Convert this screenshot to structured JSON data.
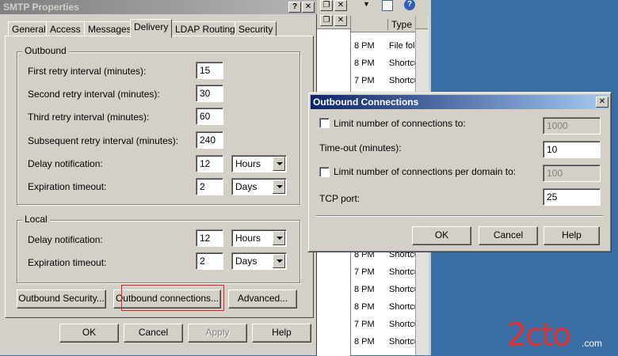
{
  "explorer": {
    "type_header": "Type",
    "rows": [
      {
        "time": "8 PM",
        "type": "File fold"
      },
      {
        "time": "8 PM",
        "type": "Shortcu"
      },
      {
        "time": "7 PM",
        "type": "Shortcu"
      },
      {
        "time": "8 PM",
        "type": "Shortcu"
      },
      {
        "time": "7 PM",
        "type": "Shortcu"
      },
      {
        "time": "8 PM",
        "type": "Shortcu"
      },
      {
        "time": "8 PM",
        "type": "Shortcu"
      },
      {
        "time": "7 PM",
        "type": "Shortcu"
      },
      {
        "time": "8 PM",
        "type": "Shortcu"
      }
    ]
  },
  "smtp_dialog": {
    "title": "SMTP Properties",
    "help_glyph": "?",
    "close_glyph": "✕",
    "tabs": [
      {
        "label": "General"
      },
      {
        "label": "Access"
      },
      {
        "label": "Messages"
      },
      {
        "label": "Delivery"
      },
      {
        "label": "LDAP Routing"
      },
      {
        "label": "Security"
      }
    ],
    "outbound": {
      "group_label": "Outbound",
      "first_retry_label": "First retry interval (minutes):",
      "first_retry_value": "15",
      "second_retry_label": "Second retry interval (minutes):",
      "second_retry_value": "30",
      "third_retry_label": "Third retry interval (minutes):",
      "third_retry_value": "60",
      "subsequent_retry_label": "Subsequent retry interval (minutes):",
      "subsequent_retry_value": "240",
      "delay_label": "Delay notification:",
      "delay_value": "12",
      "delay_unit": "Hours",
      "expiration_label": "Expiration timeout:",
      "expiration_value": "2",
      "expiration_unit": "Days"
    },
    "local": {
      "group_label": "Local",
      "delay_label": "Delay notification:",
      "delay_value": "12",
      "delay_unit": "Hours",
      "expiration_label": "Expiration timeout:",
      "expiration_value": "2",
      "expiration_unit": "Days"
    },
    "buttons": {
      "outbound_security": "Outbound Security...",
      "outbound_connections": "Outbound connections...",
      "advanced": "Advanced...",
      "ok": "OK",
      "cancel": "Cancel",
      "apply": "Apply",
      "help": "Help"
    }
  },
  "outbound_dialog": {
    "title": "Outbound Connections",
    "close_glyph": "✕",
    "limit_connections_label": "Limit number of connections to:",
    "limit_connections_value": "1000",
    "timeout_label": "Time-out (minutes):",
    "timeout_value": "10",
    "limit_per_domain_label": "Limit number of connections per domain to:",
    "limit_per_domain_value": "100",
    "tcp_port_label": "TCP port:",
    "tcp_port_value": "25",
    "buttons": {
      "ok": "OK",
      "cancel": "Cancel",
      "help": "Help"
    }
  },
  "watermark": {
    "text": "2cto",
    "suffix": ".com"
  }
}
